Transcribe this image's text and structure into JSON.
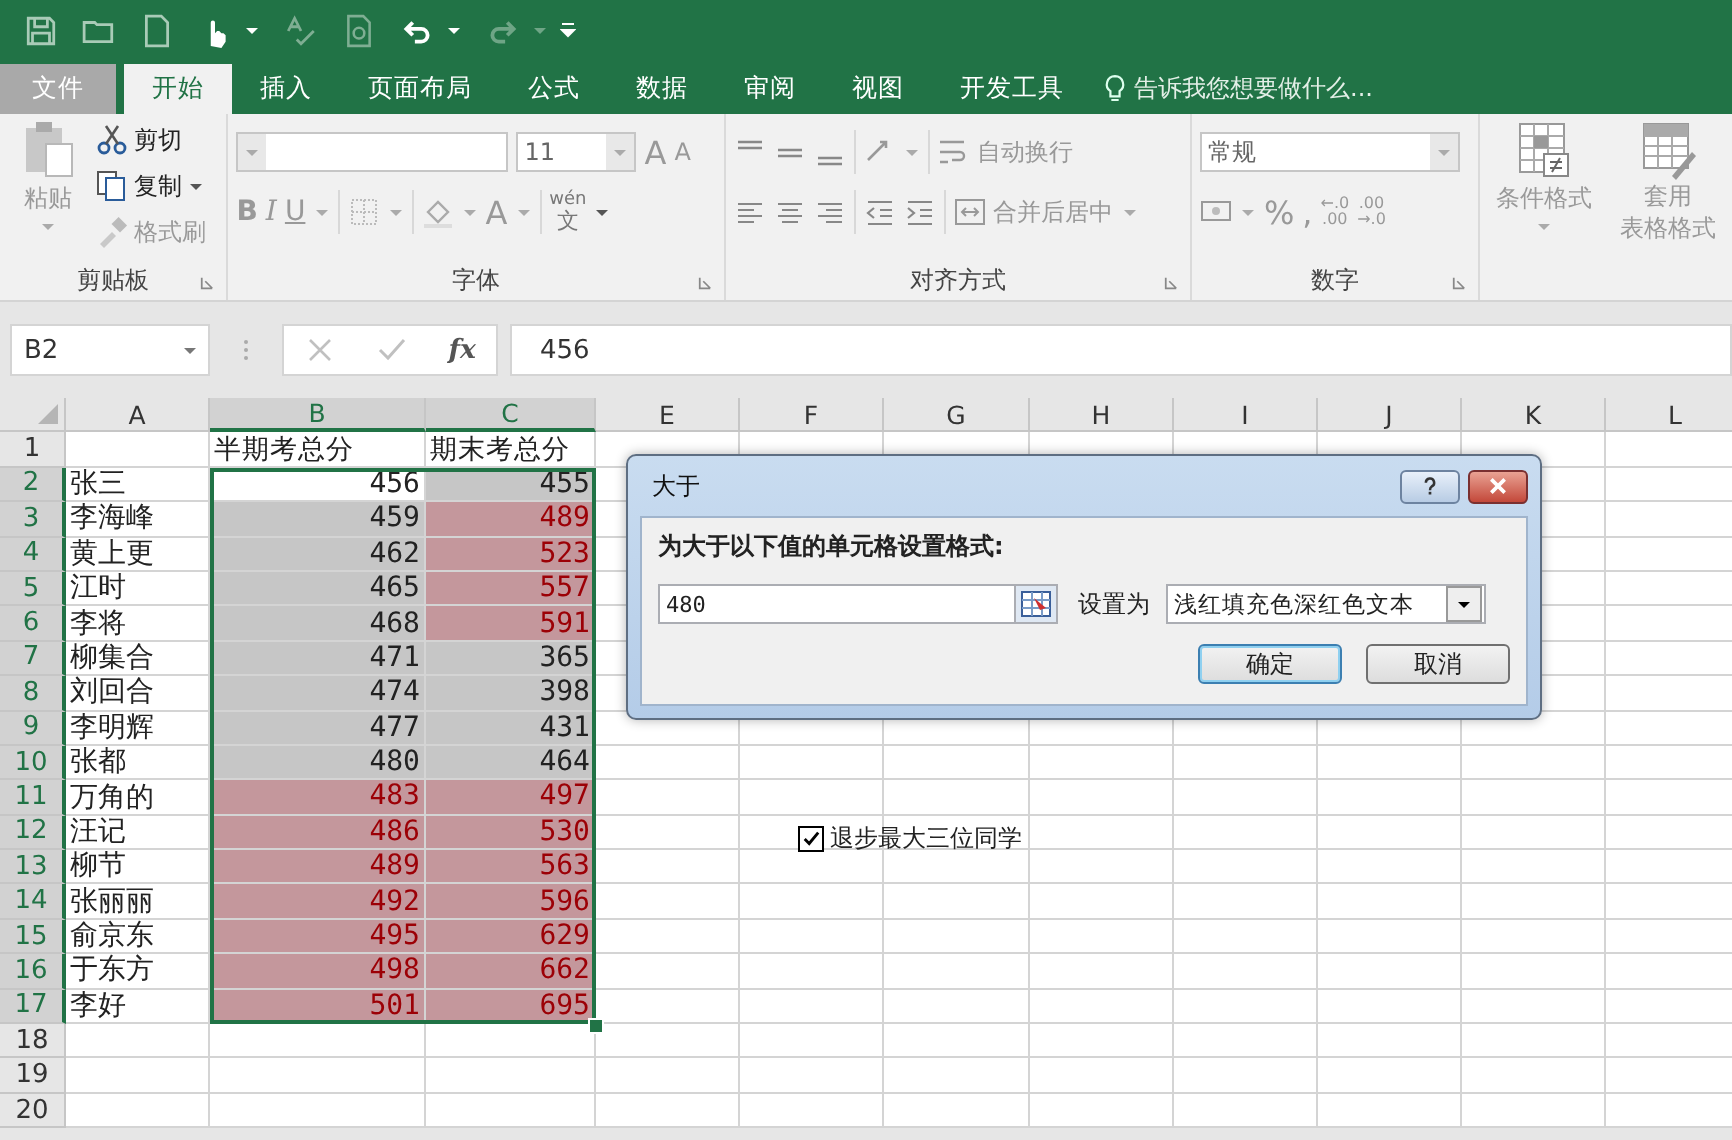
{
  "tabs": [
    {
      "label": "文件",
      "kind": "file",
      "selected": false
    },
    {
      "label": "开始",
      "kind": "tab",
      "selected": true
    },
    {
      "label": "插入",
      "kind": "tab",
      "selected": false
    },
    {
      "label": "页面布局",
      "kind": "tab",
      "selected": false
    },
    {
      "label": "公式",
      "kind": "tab",
      "selected": false
    },
    {
      "label": "数据",
      "kind": "tab",
      "selected": false
    },
    {
      "label": "审阅",
      "kind": "tab",
      "selected": false
    },
    {
      "label": "视图",
      "kind": "tab",
      "selected": false
    },
    {
      "label": "开发工具",
      "kind": "tab",
      "selected": false
    }
  ],
  "tell_me": "告诉我您想要做什么...",
  "ribbon": {
    "clipboard": {
      "title": "剪贴板",
      "paste": "粘贴",
      "cut": "剪切",
      "copy": "复制",
      "format_painter": "格式刷"
    },
    "font": {
      "title": "字体",
      "font_size": "11",
      "grow": "A",
      "shrink": "A",
      "bold": "B",
      "italic": "I",
      "underline": "U",
      "font_color": "A",
      "phonetic_top": "wén",
      "phonetic_bottom": "文"
    },
    "alignment": {
      "title": "对齐方式",
      "wrap": "自动换行",
      "merge": "合并后居中"
    },
    "number": {
      "title": "数字",
      "format": "常规",
      "percent": "%",
      "comma": ",",
      "increase_decimal": [
        "←.0",
        ".00"
      ],
      "decrease_decimal": [
        ".00",
        "→.0"
      ]
    },
    "styles": {
      "conditional": "条件格式",
      "table_top": "套用",
      "table_bottom": "表格格式"
    }
  },
  "name_box": "B2",
  "fx": "fx",
  "formula": "456",
  "columns": [
    {
      "label": "A",
      "selected": false
    },
    {
      "label": "B",
      "selected": true
    },
    {
      "label": "C",
      "selected": true
    },
    {
      "label": "E",
      "selected": false
    },
    {
      "label": "F",
      "selected": false
    },
    {
      "label": "G",
      "selected": false
    },
    {
      "label": "H",
      "selected": false
    },
    {
      "label": "I",
      "selected": false
    },
    {
      "label": "J",
      "selected": false
    },
    {
      "label": "K",
      "selected": false
    },
    {
      "label": "L",
      "selected": false
    }
  ],
  "header_row": {
    "number": "1",
    "selected": false,
    "b": "半期考总分",
    "c": "期末考总分"
  },
  "rows": [
    {
      "number": "2",
      "selected": true,
      "name": "张三",
      "mid": {
        "value": "456",
        "selected": false,
        "highlighted": false
      },
      "final": {
        "value": "455",
        "selected": true,
        "highlighted": false
      }
    },
    {
      "number": "3",
      "selected": true,
      "name": "李海峰",
      "mid": {
        "value": "459",
        "selected": true,
        "highlighted": false
      },
      "final": {
        "value": "489",
        "selected": true,
        "highlighted": true
      }
    },
    {
      "number": "4",
      "selected": true,
      "name": "黄上更",
      "mid": {
        "value": "462",
        "selected": true,
        "highlighted": false
      },
      "final": {
        "value": "523",
        "selected": true,
        "highlighted": true
      }
    },
    {
      "number": "5",
      "selected": true,
      "name": "江时",
      "mid": {
        "value": "465",
        "selected": true,
        "highlighted": false
      },
      "final": {
        "value": "557",
        "selected": true,
        "highlighted": true
      }
    },
    {
      "number": "6",
      "selected": true,
      "name": "李将",
      "mid": {
        "value": "468",
        "selected": true,
        "highlighted": false
      },
      "final": {
        "value": "591",
        "selected": true,
        "highlighted": true
      }
    },
    {
      "number": "7",
      "selected": true,
      "name": "柳集合",
      "mid": {
        "value": "471",
        "selected": true,
        "highlighted": false
      },
      "final": {
        "value": "365",
        "selected": true,
        "highlighted": false
      }
    },
    {
      "number": "8",
      "selected": true,
      "name": "刘回合",
      "mid": {
        "value": "474",
        "selected": true,
        "highlighted": false
      },
      "final": {
        "value": "398",
        "selected": true,
        "highlighted": false
      }
    },
    {
      "number": "9",
      "selected": true,
      "name": "李明辉",
      "mid": {
        "value": "477",
        "selected": true,
        "highlighted": false
      },
      "final": {
        "value": "431",
        "selected": true,
        "highlighted": false
      }
    },
    {
      "number": "10",
      "selected": true,
      "name": "张都",
      "mid": {
        "value": "480",
        "selected": true,
        "highlighted": false
      },
      "final": {
        "value": "464",
        "selected": true,
        "highlighted": false
      }
    },
    {
      "number": "11",
      "selected": true,
      "name": "万角的",
      "mid": {
        "value": "483",
        "selected": true,
        "highlighted": true
      },
      "final": {
        "value": "497",
        "selected": true,
        "highlighted": true
      }
    },
    {
      "number": "12",
      "selected": true,
      "name": "汪记",
      "mid": {
        "value": "486",
        "selected": true,
        "highlighted": true
      },
      "final": {
        "value": "530",
        "selected": true,
        "highlighted": true
      }
    },
    {
      "number": "13",
      "selected": true,
      "name": "柳节",
      "mid": {
        "value": "489",
        "selected": true,
        "highlighted": true
      },
      "final": {
        "value": "563",
        "selected": true,
        "highlighted": true
      }
    },
    {
      "number": "14",
      "selected": true,
      "name": "张丽丽",
      "mid": {
        "value": "492",
        "selected": true,
        "highlighted": true
      },
      "final": {
        "value": "596",
        "selected": true,
        "highlighted": true
      }
    },
    {
      "number": "15",
      "selected": true,
      "name": "俞京东",
      "mid": {
        "value": "495",
        "selected": true,
        "highlighted": true
      },
      "final": {
        "value": "629",
        "selected": true,
        "highlighted": true
      }
    },
    {
      "number": "16",
      "selected": true,
      "name": "于东方",
      "mid": {
        "value": "498",
        "selected": true,
        "highlighted": true
      },
      "final": {
        "value": "662",
        "selected": true,
        "highlighted": true
      }
    },
    {
      "number": "17",
      "selected": true,
      "name": "李好",
      "mid": {
        "value": "501",
        "selected": true,
        "highlighted": true
      },
      "final": {
        "value": "695",
        "selected": true,
        "highlighted": true
      }
    }
  ],
  "empty_rows": [
    {
      "number": "18",
      "selected": false
    },
    {
      "number": "19",
      "selected": false
    },
    {
      "number": "20",
      "selected": false
    }
  ],
  "checkbox": {
    "label": "退步最大三位同学",
    "checked": true
  },
  "dialog": {
    "title": "大于",
    "prompt": "为大于以下值的单元格设置格式:",
    "value": "480",
    "with_label": "设置为",
    "format": "浅红填充色深红色文本",
    "ok": "确定",
    "cancel": "取消"
  }
}
